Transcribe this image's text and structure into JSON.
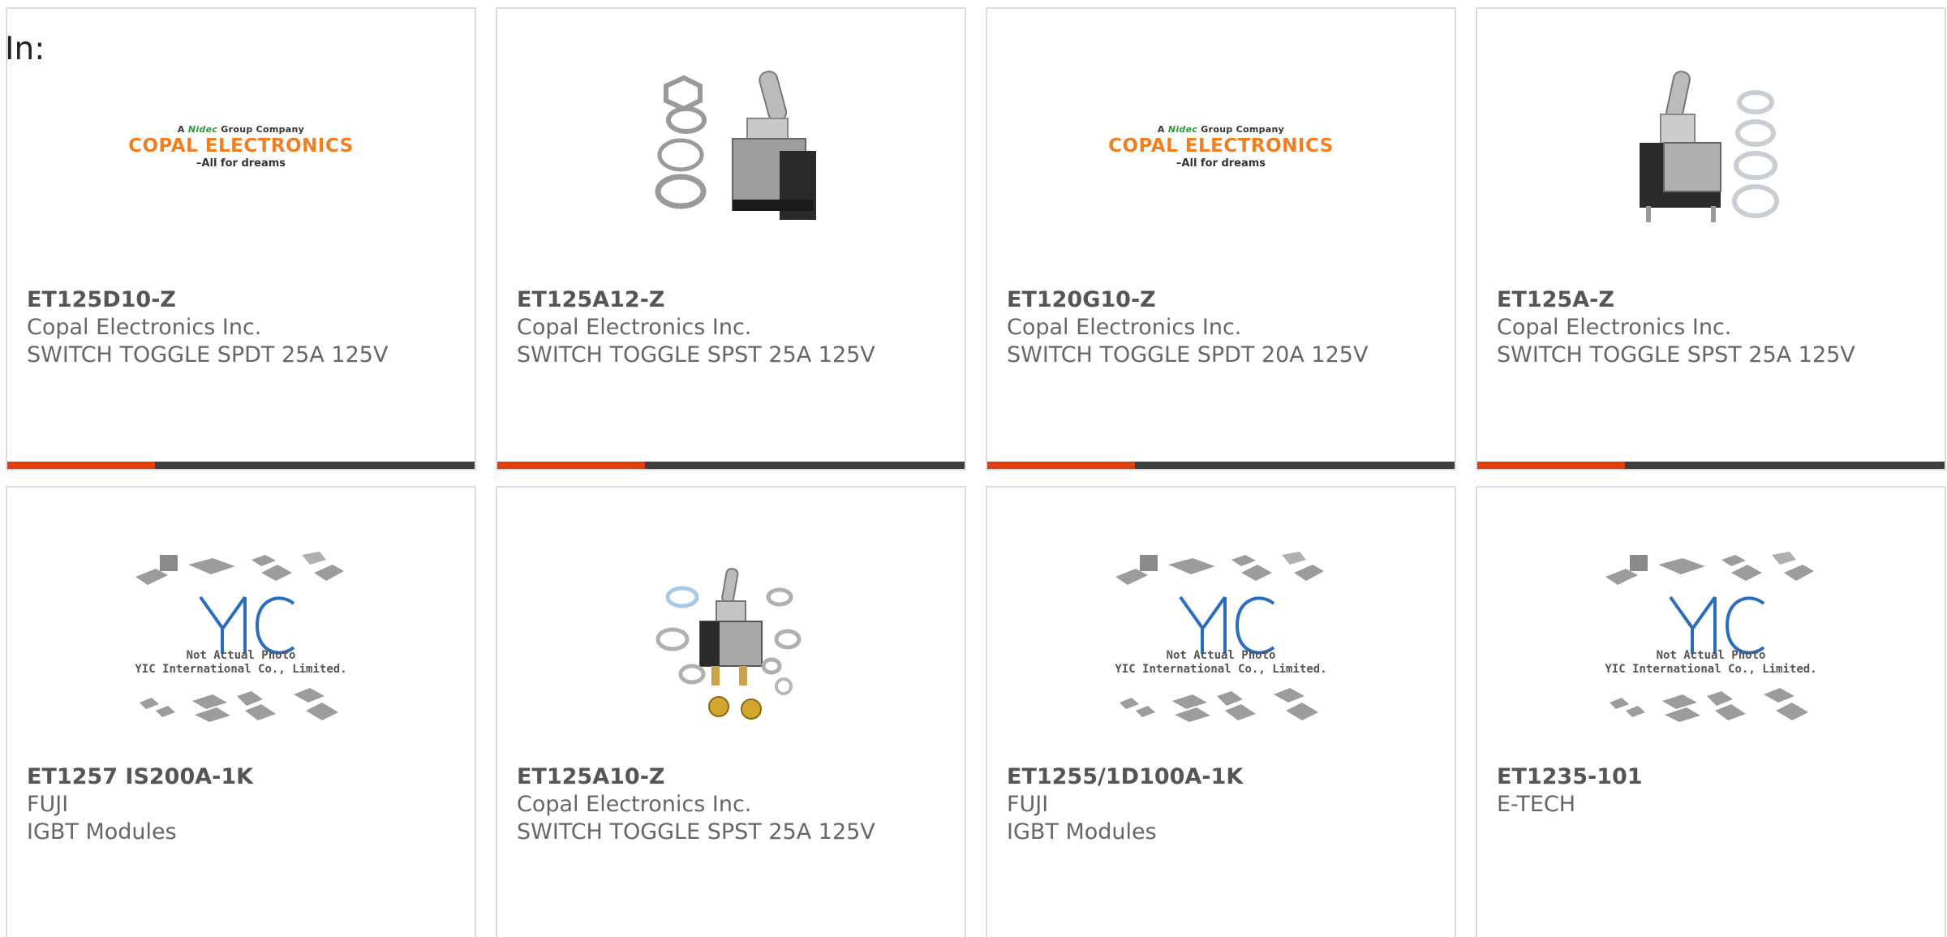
{
  "header": {
    "in_label": "In:"
  },
  "colors": {
    "accent": "#e0400f",
    "bar_dark": "#3d3d3d",
    "card_border": "#dddddd",
    "text": "#555555"
  },
  "logo_text": {
    "copal_top_prefix": "A",
    "copal_top_brand": "Nidec",
    "copal_top_suffix": "Group Company",
    "copal_main": "COPAL ELECTRONICS",
    "copal_tagline": "–All for dreams",
    "yic_line1": "Not Actual Photo",
    "yic_line2": "YIC International Co., Limited."
  },
  "products": [
    {
      "part": "ET125D10-Z",
      "maker": "Copal Electronics Inc.",
      "desc": "SWITCH TOGGLE SPDT 25A 125V",
      "image": "copal-logo"
    },
    {
      "part": "ET125A12-Z",
      "maker": "Copal Electronics Inc.",
      "desc": "SWITCH TOGGLE SPST 25A 125V",
      "image": "toggle-switch-photo"
    },
    {
      "part": "ET120G10-Z",
      "maker": "Copal Electronics Inc.",
      "desc": "SWITCH TOGGLE SPDT 20A 125V",
      "image": "copal-logo"
    },
    {
      "part": "ET125A-Z",
      "maker": "Copal Electronics Inc.",
      "desc": "SWITCH TOGGLE SPST 25A 125V",
      "image": "toggle-switch-photo"
    },
    {
      "part": "ET1257 IS200A-1K",
      "maker": "FUJI",
      "desc": "IGBT Modules",
      "image": "yic-placeholder"
    },
    {
      "part": "ET125A10-Z",
      "maker": "Copal Electronics Inc.",
      "desc": "SWITCH TOGGLE SPST 25A 125V",
      "image": "toggle-switch-photo"
    },
    {
      "part": "ET1255/1D100A-1K",
      "maker": "FUJI",
      "desc": "IGBT Modules",
      "image": "yic-placeholder"
    },
    {
      "part": "ET1235-101",
      "maker": "E-TECH",
      "desc": "",
      "image": "yic-placeholder"
    }
  ]
}
